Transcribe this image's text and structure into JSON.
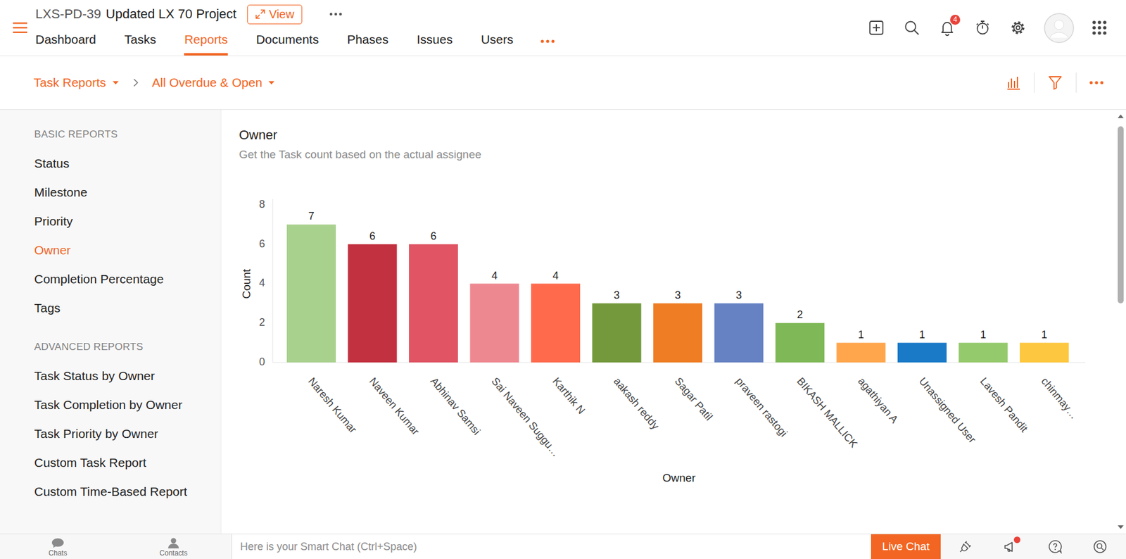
{
  "project": {
    "code": "LXS-PD-39",
    "name": "Updated LX 70 Project",
    "view_button": "View"
  },
  "nav": {
    "tabs": [
      {
        "label": "Dashboard",
        "selected": false
      },
      {
        "label": "Tasks",
        "selected": false
      },
      {
        "label": "Reports",
        "selected": true
      },
      {
        "label": "Documents",
        "selected": false
      },
      {
        "label": "Phases",
        "selected": false
      },
      {
        "label": "Issues",
        "selected": false
      },
      {
        "label": "Users",
        "selected": false
      }
    ]
  },
  "notifications": {
    "count": "4"
  },
  "breadcrumb": {
    "report_type": "Task Reports",
    "filter": "All Overdue & Open"
  },
  "sidebar": {
    "sections": [
      {
        "title": "BASIC REPORTS",
        "items": [
          {
            "label": "Status",
            "selected": false
          },
          {
            "label": "Milestone",
            "selected": false
          },
          {
            "label": "Priority",
            "selected": false
          },
          {
            "label": "Owner",
            "selected": true
          },
          {
            "label": "Completion Percentage",
            "selected": false
          },
          {
            "label": "Tags",
            "selected": false
          }
        ]
      },
      {
        "title": "ADVANCED REPORTS",
        "items": [
          {
            "label": "Task Status by Owner",
            "selected": false
          },
          {
            "label": "Task Completion by Owner",
            "selected": false
          },
          {
            "label": "Task Priority by Owner",
            "selected": false
          },
          {
            "label": "Custom Task Report",
            "selected": false
          },
          {
            "label": "Custom Time-Based Report",
            "selected": false
          }
        ]
      }
    ]
  },
  "chart": {
    "title": "Owner",
    "subtitle": "Get the Task count based on the actual assignee",
    "y_axis": {
      "label": "Count",
      "ticks": [
        "0",
        "2",
        "4",
        "6",
        "8"
      ]
    },
    "x_axis": {
      "label": "Owner"
    },
    "series": [
      {
        "name": "Count",
        "values": [
          7,
          6,
          6,
          4,
          4,
          3,
          3,
          3,
          2,
          1,
          1,
          1,
          1
        ]
      }
    ],
    "bars": [
      {
        "label": "Naresh Kumar",
        "value_label": "7",
        "color": "#a9d18e"
      },
      {
        "label": "Naveen Kumar",
        "value_label": "6",
        "color": "#c23140"
      },
      {
        "label": "Abhinav Samsi",
        "value_label": "6",
        "color": "#e05463"
      },
      {
        "label": "Sai Naveen Suggu…",
        "value_label": "4",
        "color": "#ee8890"
      },
      {
        "label": "Karthik N",
        "value_label": "4",
        "color": "#ff6a4d"
      },
      {
        "label": "aakash reddy",
        "value_label": "3",
        "color": "#73993c"
      },
      {
        "label": "Sagar Patil",
        "value_label": "3",
        "color": "#ee7d24"
      },
      {
        "label": "praveen rastogi",
        "value_label": "3",
        "color": "#6682c3"
      },
      {
        "label": "BIKASH MALLICK",
        "value_label": "2",
        "color": "#7fb957"
      },
      {
        "label": "agathiyan A",
        "value_label": "1",
        "color": "#ffa64d"
      },
      {
        "label": "Unassigned User",
        "value_label": "1",
        "color": "#1a7ac8"
      },
      {
        "label": "Lavesh Pandit",
        "value_label": "1",
        "color": "#95ca6c"
      },
      {
        "label": "chinmay…",
        "value_label": "1",
        "color": "#fdc83f"
      }
    ]
  },
  "bottom_bar": {
    "chats": "Chats",
    "contacts": "Contacts",
    "smart_chat_placeholder": "Here is your Smart Chat (Ctrl+Space)",
    "live_chat": "Live Chat",
    "announcements_unread": true
  }
}
